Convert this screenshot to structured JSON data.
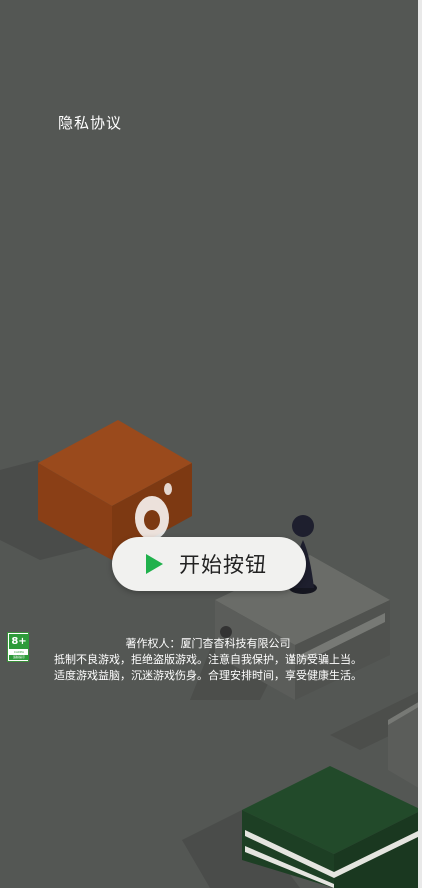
{
  "privacy": {
    "label": "隐私协议"
  },
  "start_button": {
    "label": "开始按钮",
    "icon": "play-icon",
    "icon_color": "#20b14c"
  },
  "age_rating": {
    "number": "8+",
    "small_text": "CADPA",
    "bar_text": "适龄提示"
  },
  "notice": {
    "copyright": "著作权人：厦门杳杳科技有限公司",
    "line1": "抵制不良游戏，拒绝盗版游戏。注意自我保护，谨防受骗上当。",
    "line2": "适度游戏益脑，沉迷游戏伤身。合理安排时间，享受健康生活。"
  },
  "colors": {
    "background": "#545754",
    "brown_block": "#8a3f16",
    "green_block": "#224a2a",
    "grey_block": "#5b5d5a",
    "player": "#1e1f2e"
  }
}
